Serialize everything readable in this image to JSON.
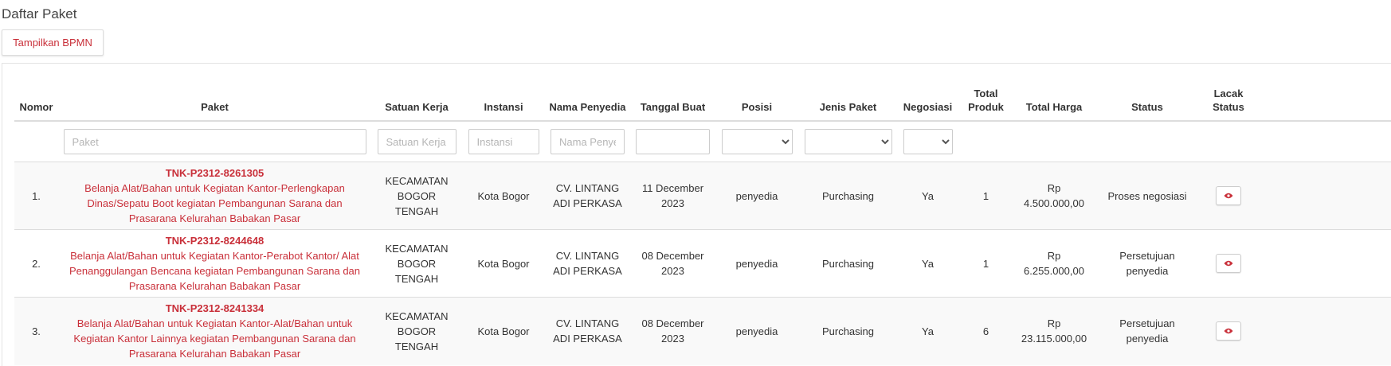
{
  "page": {
    "title": "Daftar Paket",
    "bpmn_button": "Tampilkan BPMN"
  },
  "table": {
    "headers": {
      "nomor": "Nomor",
      "paket": "Paket",
      "satuan_kerja": "Satuan Kerja",
      "instansi": "Instansi",
      "nama_penyedia": "Nama Penyedia",
      "tanggal_buat": "Tanggal Buat",
      "posisi": "Posisi",
      "jenis_paket": "Jenis Paket",
      "negosiasi": "Negosiasi",
      "total_produk": "Total Produk",
      "total_harga": "Total Harga",
      "status": "Status",
      "lacak_status": "Lacak Status"
    },
    "filters": {
      "paket_placeholder": "Paket",
      "satuan_kerja_placeholder": "Satuan Kerja",
      "instansi_placeholder": "Instansi",
      "nama_penyedia_placeholder": "Nama Penye",
      "tanggal_buat_value": "",
      "posisi_value": "",
      "jenis_paket_value": "",
      "negosiasi_value": ""
    },
    "rows": [
      {
        "nomor": "1.",
        "kode": "TNK-P2312-8261305",
        "nama": "Belanja Alat/Bahan untuk Kegiatan Kantor-Perlengkapan Dinas/Sepatu Boot kegiatan Pembangunan Sarana dan Prasarana Kelurahan Babakan Pasar",
        "satuan_kerja": "KECAMATAN BOGOR TENGAH",
        "instansi": "Kota Bogor",
        "penyedia": "CV. LINTANG ADI PERKASA",
        "tanggal": "11 December 2023",
        "posisi": "penyedia",
        "jenis": "Purchasing",
        "negosiasi": "Ya",
        "total_produk": "1",
        "total_harga": "Rp 4.500.000,00",
        "status": "Proses negosiasi"
      },
      {
        "nomor": "2.",
        "kode": "TNK-P2312-8244648",
        "nama": "Belanja Alat/Bahan untuk Kegiatan Kantor-Perabot Kantor/ Alat Penanggulangan Bencana kegiatan Pembangunan Sarana dan Prasarana Kelurahan Babakan Pasar",
        "satuan_kerja": "KECAMATAN BOGOR TENGAH",
        "instansi": "Kota Bogor",
        "penyedia": "CV. LINTANG ADI PERKASA",
        "tanggal": "08 December 2023",
        "posisi": "penyedia",
        "jenis": "Purchasing",
        "negosiasi": "Ya",
        "total_produk": "1",
        "total_harga": "Rp 6.255.000,00",
        "status": "Persetujuan penyedia"
      },
      {
        "nomor": "3.",
        "kode": "TNK-P2312-8241334",
        "nama": "Belanja Alat/Bahan untuk Kegiatan Kantor-Alat/Bahan untuk Kegiatan Kantor Lainnya kegiatan Pembangunan Sarana dan Prasarana Kelurahan Babakan Pasar",
        "satuan_kerja": "KECAMATAN BOGOR TENGAH",
        "instansi": "Kota Bogor",
        "penyedia": "CV. LINTANG ADI PERKASA",
        "tanggal": "08 December 2023",
        "posisi": "penyedia",
        "jenis": "Purchasing",
        "negosiasi": "Ya",
        "total_produk": "6",
        "total_harga": "Rp 23.115.000,00",
        "status": "Persetujuan penyedia"
      }
    ]
  },
  "icons": {
    "lacak": "eye-icon"
  },
  "colors": {
    "accent": "#c9303a"
  }
}
